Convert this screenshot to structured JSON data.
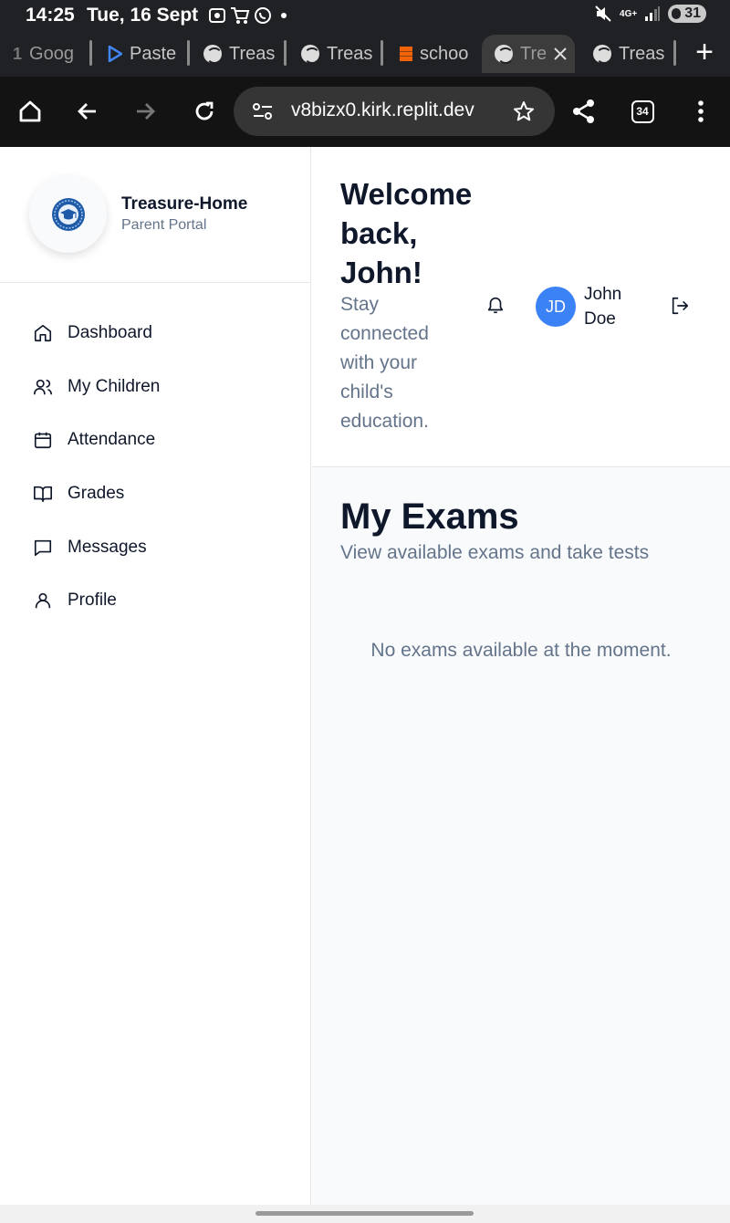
{
  "status_bar": {
    "time": "14:25",
    "date": "Tue, 16 Sept",
    "network": "4G+",
    "battery": "31"
  },
  "browser": {
    "tabs": [
      {
        "label": "Goog",
        "icon": "google-icon"
      },
      {
        "label": "Paste",
        "icon": "play-icon"
      },
      {
        "label": "Treas",
        "icon": "globe-icon"
      },
      {
        "label": "Treas",
        "icon": "globe-icon"
      },
      {
        "label": "schoo",
        "icon": "replit-icon"
      },
      {
        "label": "Tre",
        "icon": "globe-icon",
        "active": true
      },
      {
        "label": "Treas",
        "icon": "globe-icon"
      }
    ],
    "url": "v8bizx0.kirk.replit.dev",
    "tab_count": "34"
  },
  "sidebar": {
    "brand_name": "Treasure-Home",
    "brand_subtitle": "Parent Portal",
    "items": [
      {
        "label": "Dashboard",
        "icon": "home-icon"
      },
      {
        "label": "My Children",
        "icon": "users-icon"
      },
      {
        "label": "Attendance",
        "icon": "calendar-icon"
      },
      {
        "label": "Grades",
        "icon": "book-open-icon"
      },
      {
        "label": "Messages",
        "icon": "message-icon"
      },
      {
        "label": "Profile",
        "icon": "user-icon"
      }
    ]
  },
  "header": {
    "welcome": "Welcome back, John!",
    "tagline": "Stay connected with your child's education.",
    "user_initials": "JD",
    "user_name": "John Doe"
  },
  "main": {
    "title": "My Exams",
    "subtitle": "View available exams and take tests",
    "empty_message": "No exams available at the moment."
  },
  "colors": {
    "accent": "#3b82f6",
    "text_primary": "#0f172a",
    "text_muted": "#64748b",
    "browser_chrome": "#202124"
  }
}
